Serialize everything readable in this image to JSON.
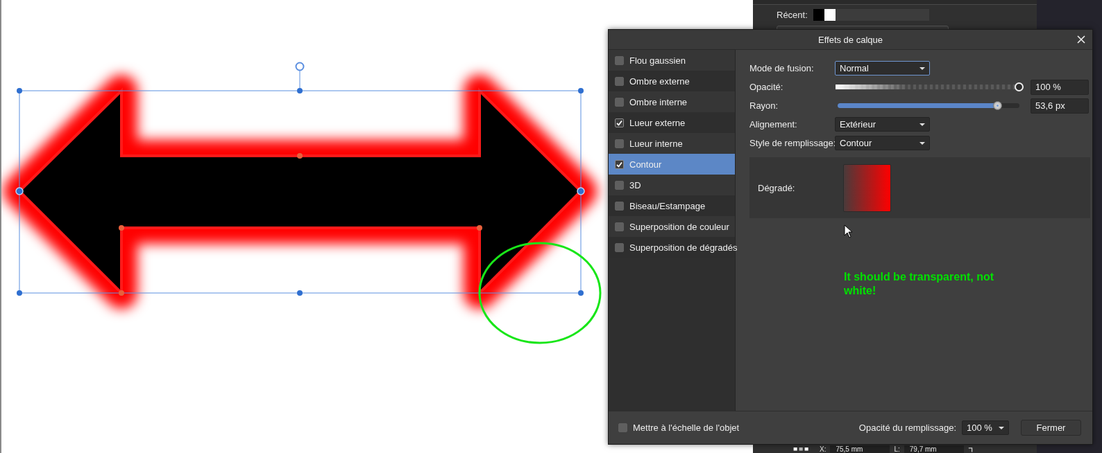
{
  "side_panel": {
    "recent_label": "Récent:",
    "recent_swatches": [
      {
        "color": "#000000"
      },
      {
        "color": "#ffffff"
      }
    ]
  },
  "transform_bar": {
    "x_label": "X:",
    "x_value": "75,5 mm",
    "w_label": "L:",
    "w_value": "79,7 mm"
  },
  "dialog": {
    "title": "Effets de calque",
    "effects": [
      {
        "label": "Flou gaussien",
        "checked": false,
        "selected": false
      },
      {
        "label": "Ombre externe",
        "checked": false,
        "selected": false
      },
      {
        "label": "Ombre interne",
        "checked": false,
        "selected": false
      },
      {
        "label": "Lueur externe",
        "checked": true,
        "selected": false
      },
      {
        "label": "Lueur interne",
        "checked": false,
        "selected": false
      },
      {
        "label": "Contour",
        "checked": true,
        "selected": true
      },
      {
        "label": "3D",
        "checked": false,
        "selected": false
      },
      {
        "label": "Biseau/Estampage",
        "checked": false,
        "selected": false
      },
      {
        "label": "Superposition de couleur",
        "checked": false,
        "selected": false
      },
      {
        "label": "Superposition de dégradés",
        "checked": false,
        "selected": false
      }
    ],
    "settings": [
      {
        "kind": "dropdown",
        "label": "Mode de fusion:",
        "value": "Normal",
        "focused": true
      },
      {
        "kind": "opacity",
        "label": "Opacité:",
        "level": 1,
        "value": "100 %"
      },
      {
        "kind": "slider",
        "label": "Rayon:",
        "level": 0.88,
        "value": "53,6 px"
      },
      {
        "kind": "dropdown",
        "label": "Alignement:",
        "value": "Extérieur",
        "focused": false
      },
      {
        "kind": "dropdown",
        "label": "Style de remplissage:",
        "value": "Contour",
        "focused": false
      }
    ],
    "gradient": {
      "label": "Dégradé:"
    },
    "footer": {
      "scale_checkbox": {
        "label": "Mettre à l'échelle de l'objet",
        "checked": false
      },
      "fill_opacity": {
        "label": "Opacité du remplissage:",
        "value": "100 %"
      },
      "close_button": "Fermer"
    }
  },
  "annotation": {
    "text": "It should be transparent, not white!"
  }
}
